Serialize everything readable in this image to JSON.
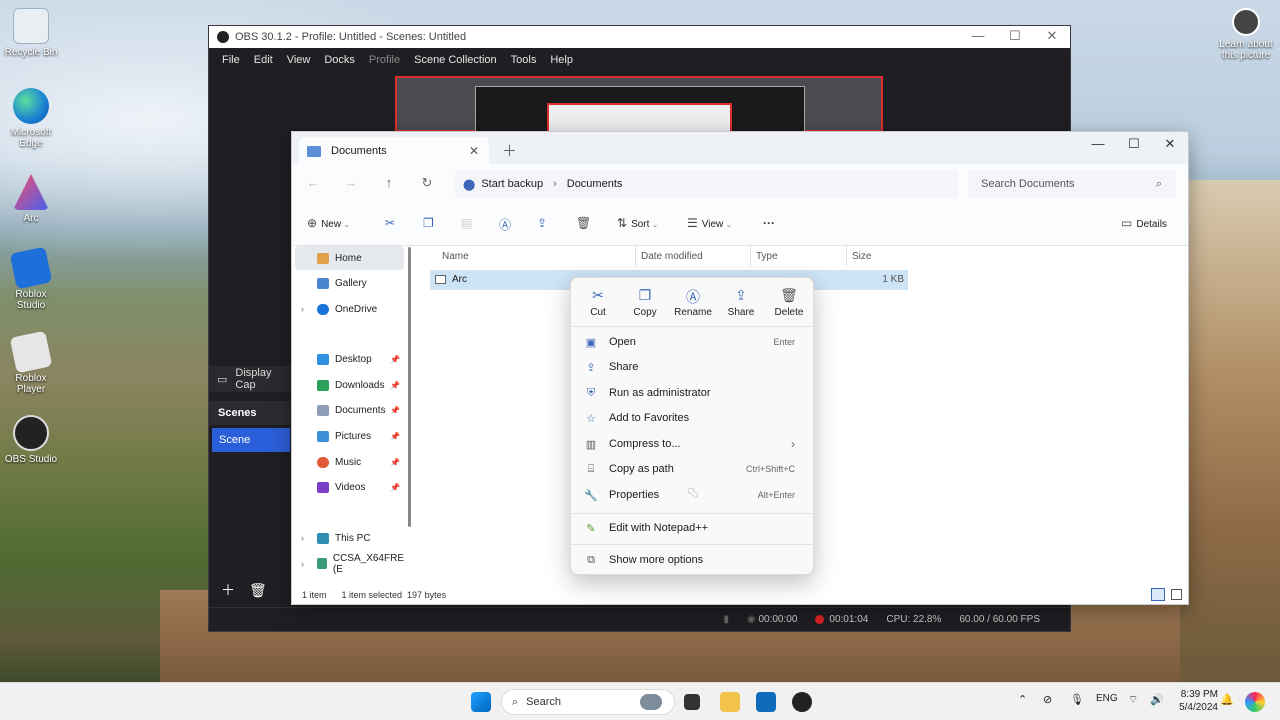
{
  "desktop": {
    "icons": [
      {
        "label": "Recycle Bin"
      },
      {
        "label": "Microsoft Edge"
      },
      {
        "label": "Arc"
      },
      {
        "label": "Roblox Studio"
      },
      {
        "label": "Roblox Player"
      },
      {
        "label": "OBS Studio"
      }
    ],
    "learn_about": "Learn about this picture"
  },
  "obs": {
    "title": "OBS 30.1.2 - Profile: Untitled - Scenes: Untitled",
    "menu": [
      "File",
      "Edit",
      "View",
      "Docks",
      "Profile",
      "Scene Collection",
      "Tools",
      "Help"
    ],
    "source": "Display Cap",
    "scenes_header": "Scenes",
    "scene_item": "Scene",
    "status": {
      "stream_time": "00:00:00",
      "rec_time": "00:01:04",
      "cpu": "CPU: 22.8%",
      "fps": "60.00 / 60.00 FPS"
    }
  },
  "explorer": {
    "tab_title": "Documents",
    "breadcrumb": [
      "Start backup",
      "Documents"
    ],
    "search_placeholder": "Search Documents",
    "commands": {
      "new": "New",
      "sort": "Sort",
      "view": "View",
      "details": "Details"
    },
    "nav": [
      {
        "label": "Home",
        "sel": true
      },
      {
        "label": "Gallery"
      },
      {
        "label": "OneDrive",
        "chev": true
      },
      {
        "label": "Desktop",
        "pin": true
      },
      {
        "label": "Downloads",
        "pin": true
      },
      {
        "label": "Documents",
        "pin": true
      },
      {
        "label": "Pictures",
        "pin": true
      },
      {
        "label": "Music",
        "pin": true
      },
      {
        "label": "Videos",
        "pin": true
      },
      {
        "label": "This PC",
        "chev": true
      },
      {
        "label": "CCSA_X64FRE (E",
        "chev": true
      }
    ],
    "columns": {
      "name": "Name",
      "date": "Date modified",
      "type": "Type",
      "size": "Size"
    },
    "row": {
      "name": "Arc",
      "size": "1 KB"
    },
    "status": {
      "count": "1 item",
      "selected": "1 item selected  197 bytes"
    }
  },
  "context_menu": {
    "quick": [
      "Cut",
      "Copy",
      "Rename",
      "Share",
      "Delete"
    ],
    "items": [
      {
        "label": "Open",
        "shortcut": "Enter"
      },
      {
        "label": "Share",
        "shortcut": ""
      },
      {
        "label": "Run as administrator",
        "shortcut": ""
      },
      {
        "label": "Add to Favorites",
        "shortcut": ""
      },
      {
        "label": "Compress to...",
        "shortcut": "›"
      },
      {
        "label": "Copy as path",
        "shortcut": "Ctrl+Shift+C"
      },
      {
        "label": "Properties",
        "shortcut": "Alt+Enter"
      }
    ],
    "notepad": "Edit with Notepad++",
    "more": "Show more options"
  },
  "taskbar": {
    "search": "Search",
    "lang": "ENG",
    "time": "8:39 PM",
    "date": "5/4/2024"
  },
  "colors": {
    "obs_scene": "#2b5fd9",
    "accent": "#3a67b7",
    "rec": "#dd2222"
  }
}
